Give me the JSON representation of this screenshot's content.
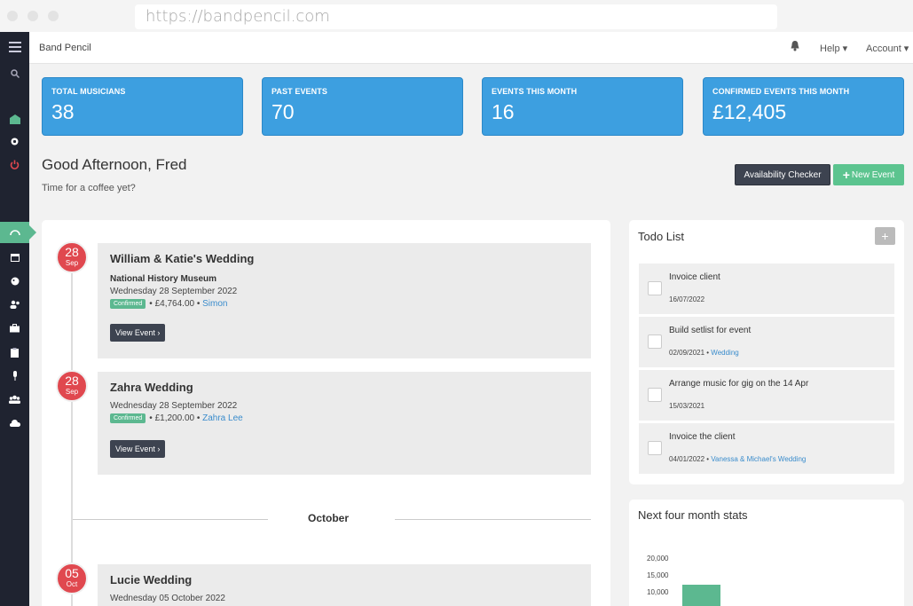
{
  "browser": {
    "url": "https://bandpencil.com"
  },
  "topbar": {
    "brand": "Band Pencil",
    "help": "Help ▾",
    "account": "Account ▾"
  },
  "stats": [
    {
      "label": "TOTAL MUSICIANS",
      "value": "38"
    },
    {
      "label": "PAST EVENTS",
      "value": "70"
    },
    {
      "label": "EVENTS THIS MONTH",
      "value": "16"
    },
    {
      "label": "CONFIRMED EVENTS THIS MONTH",
      "value": "£12,405"
    }
  ],
  "greeting": {
    "title": "Good Afternoon, Fred",
    "subtitle": "Time for a coffee yet?"
  },
  "actions": {
    "availability": "Availability Checker",
    "new_event_plus": "+",
    "new_event": "New Event"
  },
  "events": [
    {
      "day": "28",
      "month": "Sep",
      "title": "William & Katie's Wedding",
      "venue": "National History Museum",
      "date": "Wednesday 28 September 2022",
      "status": "Confirmed",
      "amount": "• £4,764.00 •",
      "contact": "Simon",
      "button": "View Event ›"
    },
    {
      "day": "28",
      "month": "Sep",
      "title": "Zahra Wedding",
      "venue": "",
      "date": "Wednesday 28 September 2022",
      "status": "Confirmed",
      "amount": "• £1,200.00 •",
      "contact": "Zahra Lee",
      "button": "View Event ›"
    },
    {
      "day": "05",
      "month": "Oct",
      "title": "Lucie Wedding",
      "venue": "",
      "date": "Wednesday 05 October 2022",
      "status": "",
      "amount": "",
      "contact": "",
      "button": ""
    }
  ],
  "month_divider": "October",
  "todo": {
    "title": "Todo List",
    "add": "+",
    "items": [
      {
        "text": "Invoice client",
        "date": "16/07/2022",
        "link": ""
      },
      {
        "text": "Build setlist for event",
        "date": "02/09/2021 •",
        "link": "Wedding"
      },
      {
        "text": "Arrange music for gig on the 14 Apr",
        "date": "15/03/2021",
        "link": ""
      },
      {
        "text": "Invoice the client",
        "date": "04/01/2022 •",
        "link": "Vanessa & Michael's Wedding"
      }
    ]
  },
  "stats_chart": {
    "title": "Next four month stats",
    "chart_data": {
      "type": "bar",
      "yticks": [
        "20,000",
        "15,000",
        "10,000"
      ],
      "values": [
        12405
      ]
    }
  },
  "colors": {
    "card_blue": "#3d9fe0",
    "sidebar": "#1f2330",
    "green": "#5cb890",
    "red": "#e0484f"
  },
  "icons": [
    "menu-icon",
    "search-icon",
    "inbox-icon",
    "gear-icon",
    "power-icon",
    "dashboard-icon",
    "calendar-icon",
    "palette-icon",
    "users-icon",
    "briefcase-icon",
    "clipboard-icon",
    "microphone-icon",
    "group-icon",
    "cloud-icon",
    "bell-icon"
  ]
}
